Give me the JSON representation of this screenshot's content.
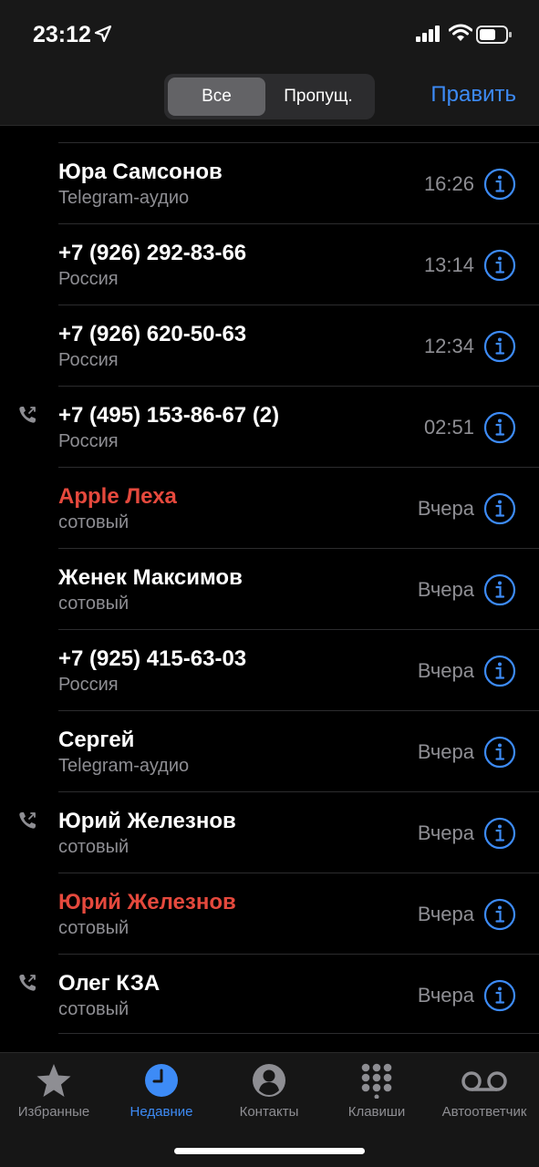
{
  "status_bar": {
    "time": "23:12"
  },
  "nav": {
    "segments": [
      "Все",
      "Пропущ."
    ],
    "selected_segment": "Все",
    "edit_label": "Править"
  },
  "calls": [
    {
      "name": "Юра Самсонов",
      "subtitle": "Telegram-аудио",
      "time": "16:26",
      "missed": false,
      "outgoing": false
    },
    {
      "name": "+7 (926) 292-83-66",
      "subtitle": "Россия",
      "time": "13:14",
      "missed": false,
      "outgoing": false
    },
    {
      "name": "+7 (926) 620-50-63",
      "subtitle": "Россия",
      "time": "12:34",
      "missed": false,
      "outgoing": false
    },
    {
      "name": "+7 (495) 153-86-67 (2)",
      "subtitle": "Россия",
      "time": "02:51",
      "missed": false,
      "outgoing": true
    },
    {
      "name": "Apple Леха",
      "subtitle": "сотовый",
      "time": "Вчера",
      "missed": true,
      "outgoing": false
    },
    {
      "name": "Женек Максимов",
      "subtitle": "сотовый",
      "time": "Вчера",
      "missed": false,
      "outgoing": false
    },
    {
      "name": "+7 (925) 415-63-03",
      "subtitle": "Россия",
      "time": "Вчера",
      "missed": false,
      "outgoing": false
    },
    {
      "name": "Сергей",
      "subtitle": "Telegram-аудио",
      "time": "Вчера",
      "missed": false,
      "outgoing": false
    },
    {
      "name": "Юрий Железнов",
      "subtitle": "сотовый",
      "time": "Вчера",
      "missed": false,
      "outgoing": true
    },
    {
      "name": "Юрий Железнов",
      "subtitle": "сотовый",
      "time": "Вчера",
      "missed": true,
      "outgoing": false
    },
    {
      "name": "Олег КЗА",
      "subtitle": "сотовый",
      "time": "Вчера",
      "missed": false,
      "outgoing": true
    }
  ],
  "tabs": [
    {
      "label": "Избранные",
      "icon": "star-icon",
      "active": false
    },
    {
      "label": "Недавние",
      "icon": "clock-icon",
      "active": true
    },
    {
      "label": "Контакты",
      "icon": "person-icon",
      "active": false
    },
    {
      "label": "Клавиши",
      "icon": "keypad-icon",
      "active": false
    },
    {
      "label": "Автоответчик",
      "icon": "voicemail-icon",
      "active": false
    }
  ],
  "colors": {
    "accent": "#3d8bf6",
    "missed": "#e5493d",
    "secondary_text": "#8e8e93",
    "background": "#000000"
  }
}
